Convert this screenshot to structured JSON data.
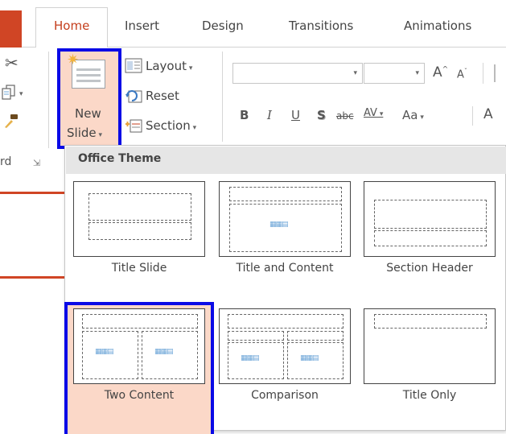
{
  "tabs": [
    {
      "label": "Home",
      "active": true
    },
    {
      "label": "Insert"
    },
    {
      "label": "Design"
    },
    {
      "label": "Transitions"
    },
    {
      "label": "Animations"
    }
  ],
  "clipboard": {
    "cut_icon": "scissors-icon",
    "copy_icon": "copy-icon",
    "painter_icon": "format-painter-icon",
    "group_label": "rd"
  },
  "slides_group": {
    "new_slide_line1": "New",
    "new_slide_line2": "Slide",
    "layout_label": "Layout",
    "reset_label": "Reset",
    "section_label": "Section"
  },
  "font_group": {
    "grow_font": "A",
    "shrink_font": "A",
    "bold": "B",
    "italic": "I",
    "underline": "U",
    "shadow": "S",
    "strikethrough": "abc",
    "spacing": "AV",
    "change_case": "Aa",
    "font_color": "A"
  },
  "gallery": {
    "header": "Office Theme",
    "layouts": [
      {
        "label": "Title Slide"
      },
      {
        "label": "Title and Content"
      },
      {
        "label": "Section Header"
      },
      {
        "label": "Two Content",
        "selected": true
      },
      {
        "label": "Comparison"
      },
      {
        "label": "Title Only"
      }
    ]
  },
  "colors": {
    "accent": "#c43e1c",
    "brand_strip": "#d04525",
    "highlight_box": "#0a0ae6",
    "selected_fill": "#fbd8c8"
  }
}
